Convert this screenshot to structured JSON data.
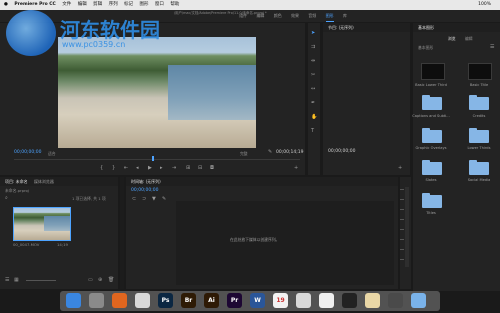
{
  "menubar": {
    "apple": "",
    "app_name": "Premiere Pro CC",
    "items": [
      "文件",
      "编辑",
      "剪辑",
      "序列",
      "标记",
      "图形",
      "窗口",
      "帮助"
    ],
    "right_text": "100%"
  },
  "window_title": "/用户/mac/文档/Adobe/Premiere Pro/11.0/未命名.prproj *",
  "workspace_tabs": [
    "组件",
    "编辑",
    "颜色",
    "效果",
    "音频",
    "图形",
    "库"
  ],
  "workspace_active": "图形",
  "source_panel": {
    "timecode_left": "00;00;00;00",
    "fit_label": "适合",
    "timecode_right": "00;00;14;19",
    "full_label": "完整"
  },
  "program_panel": {
    "tab": "节目: (无序列)",
    "timecode_left": "00;00;00;00"
  },
  "graphics_panel": {
    "title": "基本图形",
    "tabs": [
      "浏览",
      "编辑"
    ],
    "filter_label": "基本图形",
    "tiles": [
      {
        "label": "Basic Lower Third",
        "type": "dark"
      },
      {
        "label": "Basic Title",
        "type": "dark"
      },
      {
        "label": "Captions and Subti...",
        "type": "folder"
      },
      {
        "label": "Credits",
        "type": "folder"
      },
      {
        "label": "Graphic Overlays",
        "type": "folder"
      },
      {
        "label": "Lower Thirds",
        "type": "folder"
      },
      {
        "label": "Slates",
        "type": "folder"
      },
      {
        "label": "Social Media",
        "type": "folder"
      },
      {
        "label": "Titles",
        "type": "folder"
      }
    ]
  },
  "project_panel": {
    "tabs": [
      "项目: 未命名",
      "媒体浏览器"
    ],
    "project_file": "未命名.prproj",
    "item_count": "1 项已选择, 共 1 项",
    "clip_name": "00_0047.MOV",
    "clip_duration": "14;19"
  },
  "timeline_panel": {
    "tab": "时间轴: (无序列)",
    "timecode": "00;00;00;00",
    "empty_message": "在此处放下媒体以创建序列。"
  },
  "watermark": {
    "title": "河东软件园",
    "url": "www.pc0359.cn"
  },
  "dock_icons": [
    {
      "name": "finder-icon",
      "label": "",
      "color": "#3a86e0"
    },
    {
      "name": "launchpad-icon",
      "label": "",
      "color": "#8a8a8a"
    },
    {
      "name": "firefox-icon",
      "label": "",
      "color": "#e0661f"
    },
    {
      "name": "chrome-icon",
      "label": "",
      "color": "#d8d8d8"
    },
    {
      "name": "photoshop-icon",
      "label": "Ps",
      "color": "#0b2742"
    },
    {
      "name": "bridge-icon",
      "label": "Br",
      "color": "#2e1b05"
    },
    {
      "name": "illustrator-icon",
      "label": "Ai",
      "color": "#2e1a05"
    },
    {
      "name": "premiere-icon",
      "label": "Pr",
      "color": "#1d0733"
    },
    {
      "name": "word-icon",
      "label": "W",
      "color": "#2a5699"
    },
    {
      "name": "calendar-icon",
      "label": "19",
      "color": "#f2f2f2"
    },
    {
      "name": "preview-icon",
      "label": "",
      "color": "#d9d9d9"
    },
    {
      "name": "photos-icon",
      "label": "",
      "color": "#f0f0f0"
    },
    {
      "name": "terminal-icon",
      "label": "",
      "color": "#222222"
    },
    {
      "name": "folder-icon",
      "label": "",
      "color": "#e9d7a6"
    },
    {
      "name": "quicktime-icon",
      "label": "",
      "color": "#4a4a4a"
    },
    {
      "name": "downloads-icon",
      "label": "",
      "color": "#7ab3ea"
    }
  ]
}
